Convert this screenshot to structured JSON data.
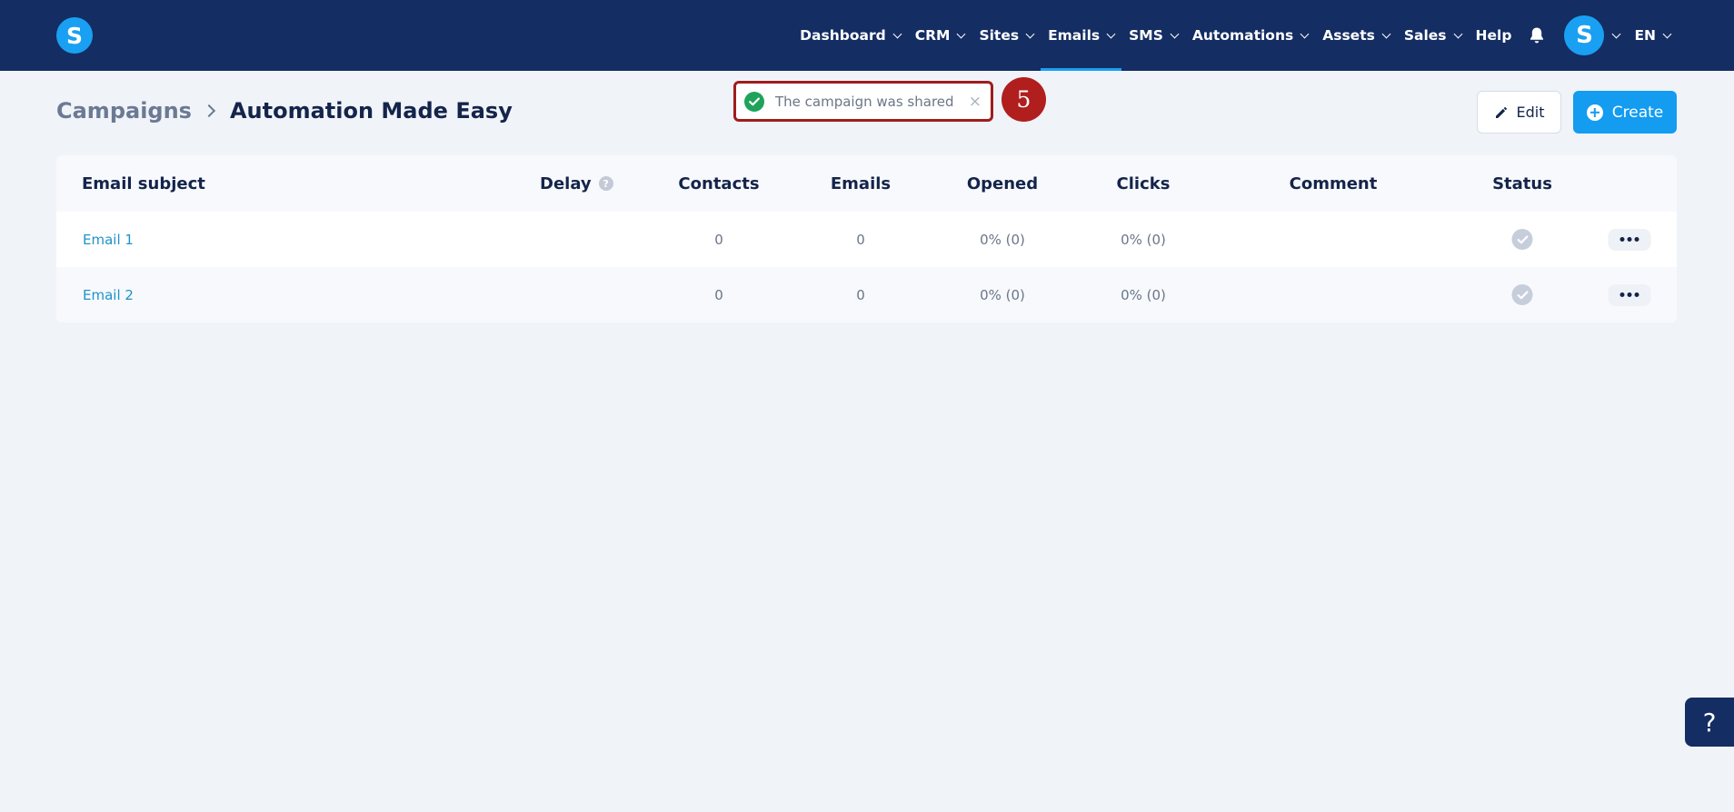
{
  "brand": {
    "logo_letter": "S"
  },
  "nav": {
    "items": [
      {
        "label": "Dashboard",
        "dropdown": true,
        "active": false
      },
      {
        "label": "CRM",
        "dropdown": true,
        "active": false
      },
      {
        "label": "Sites",
        "dropdown": true,
        "active": false
      },
      {
        "label": "Emails",
        "dropdown": true,
        "active": true
      },
      {
        "label": "SMS",
        "dropdown": true,
        "active": false
      },
      {
        "label": "Automations",
        "dropdown": true,
        "active": false
      },
      {
        "label": "Assets",
        "dropdown": true,
        "active": false
      },
      {
        "label": "Sales",
        "dropdown": true,
        "active": false
      },
      {
        "label": "Help",
        "dropdown": false,
        "active": false
      }
    ],
    "bell_icon": "bell-icon",
    "avatar_letter": "S",
    "language": "EN"
  },
  "breadcrumb": {
    "parent": "Campaigns",
    "current": "Automation Made Easy"
  },
  "toast": {
    "message": "The campaign was shared",
    "close_symbol": "×",
    "status_color": "#1fa35a"
  },
  "step_badge": "5",
  "actions": {
    "edit_label": "Edit",
    "create_label": "Create"
  },
  "table": {
    "columns": {
      "subject": "Email subject",
      "delay": "Delay",
      "delay_help": "?",
      "contacts": "Contacts",
      "emails": "Emails",
      "opened": "Opened",
      "clicks": "Clicks",
      "comment": "Comment",
      "status": "Status"
    },
    "rows": [
      {
        "subject": "Email 1",
        "delay": "",
        "contacts": "0",
        "emails": "0",
        "opened": "0% (0)",
        "clicks": "0% (0)",
        "comment": "",
        "status": "check"
      },
      {
        "subject": "Email 2",
        "delay": "",
        "contacts": "0",
        "emails": "0",
        "opened": "0% (0)",
        "clicks": "0% (0)",
        "comment": "",
        "status": "check"
      }
    ]
  },
  "help_widget": {
    "label": "?"
  },
  "colors": {
    "navbar": "#142d63",
    "accent": "#139cf0",
    "link": "#1f93c9",
    "highlight_frame": "#a01c1c"
  }
}
